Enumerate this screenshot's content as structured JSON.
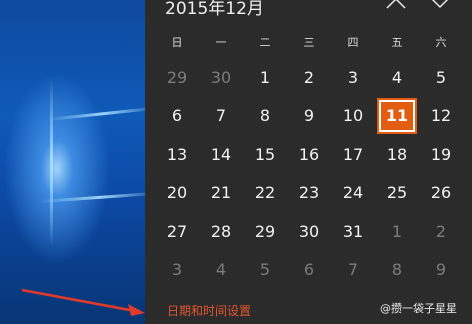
{
  "calendar": {
    "month_title": "2015年12月",
    "weekdays": [
      "日",
      "一",
      "二",
      "三",
      "四",
      "五",
      "六"
    ],
    "weeks": [
      [
        {
          "d": "29",
          "m": true
        },
        {
          "d": "30",
          "m": true
        },
        {
          "d": "1"
        },
        {
          "d": "2"
        },
        {
          "d": "3"
        },
        {
          "d": "4"
        },
        {
          "d": "5"
        }
      ],
      [
        {
          "d": "6"
        },
        {
          "d": "7"
        },
        {
          "d": "8"
        },
        {
          "d": "9"
        },
        {
          "d": "10"
        },
        {
          "d": "11",
          "today": true
        },
        {
          "d": "12"
        }
      ],
      [
        {
          "d": "13"
        },
        {
          "d": "14"
        },
        {
          "d": "15"
        },
        {
          "d": "16"
        },
        {
          "d": "17"
        },
        {
          "d": "18"
        },
        {
          "d": "19"
        }
      ],
      [
        {
          "d": "20"
        },
        {
          "d": "21"
        },
        {
          "d": "22"
        },
        {
          "d": "23"
        },
        {
          "d": "24"
        },
        {
          "d": "25"
        },
        {
          "d": "26"
        }
      ],
      [
        {
          "d": "27"
        },
        {
          "d": "28"
        },
        {
          "d": "29"
        },
        {
          "d": "30"
        },
        {
          "d": "31"
        },
        {
          "d": "1",
          "m": true
        },
        {
          "d": "2",
          "m": true
        }
      ],
      [
        {
          "d": "3",
          "m": true
        },
        {
          "d": "4",
          "m": true
        },
        {
          "d": "5",
          "m": true
        },
        {
          "d": "6",
          "m": true
        },
        {
          "d": "7",
          "m": true
        },
        {
          "d": "8",
          "m": true
        },
        {
          "d": "9",
          "m": true
        }
      ]
    ],
    "prev_icon": "chevron-up-icon",
    "next_icon": "chevron-down-icon"
  },
  "footer": {
    "settings_link": "日期和时间设置"
  },
  "watermark": {
    "text": "@攒一袋子星星"
  },
  "colors": {
    "accent": "#e35d10",
    "link": "#e3562f",
    "panel_bg": "#2b2b2b",
    "arrow": "#e23a2a"
  }
}
